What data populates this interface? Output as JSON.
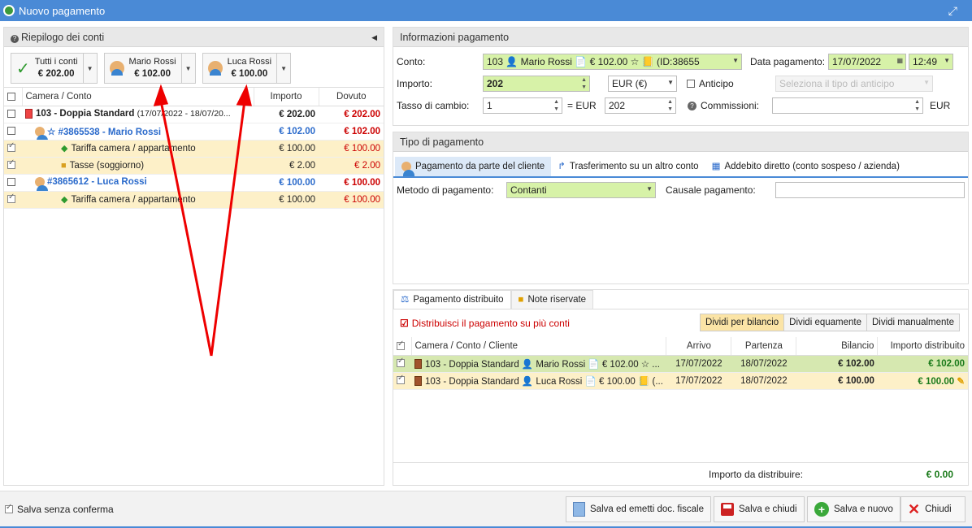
{
  "window": {
    "title": "Nuovo pagamento"
  },
  "left": {
    "title": "Riepilogo dei conti",
    "accounts": [
      {
        "name": "Tutti i conti",
        "amount": "€ 202.00"
      },
      {
        "name": "Mario Rossi",
        "amount": "€ 102.00"
      },
      {
        "name": "Luca Rossi",
        "amount": "€ 100.00"
      }
    ],
    "columns": [
      "Camera / Conto",
      "Importo",
      "Dovuto"
    ],
    "rows": [
      {
        "label": "103 - Doppia Standard",
        "sub": "(17/07/2022 - 18/07/20...",
        "importo": "€ 202.00",
        "dovuto": "€ 202.00"
      },
      {
        "label": "☆ #3865538 - Mario Rossi",
        "importo": "€ 102.00",
        "dovuto": "€ 102.00"
      },
      {
        "label": "Tariffa camera / appartamento",
        "importo": "€ 100.00",
        "dovuto": "€ 100.00"
      },
      {
        "label": "Tasse (soggiorno)",
        "importo": "€ 2.00",
        "dovuto": "€ 2.00"
      },
      {
        "label": "#3865612 - Luca Rossi",
        "importo": "€ 100.00",
        "dovuto": "€ 100.00"
      },
      {
        "label": "Tariffa camera / appartamento",
        "importo": "€ 100.00",
        "dovuto": "€ 100.00"
      }
    ]
  },
  "info": {
    "title": "Informazioni pagamento",
    "conto_label": "Conto:",
    "conto_value": "103 👤 Mario Rossi 📄 € 102.00 ☆ 📒 (ID:38655",
    "data_label": "Data pagamento:",
    "data_value": "17/07/2022",
    "time_value": "12:49",
    "importo_label": "Importo:",
    "importo_value": "202",
    "currency": "EUR (€)",
    "anticipo_label": "Anticipo",
    "anticipo_placeholder": "Seleziona il tipo di anticipo",
    "tasso_label": "Tasso di cambio:",
    "tasso_value": "1",
    "eq_eur": "= EUR",
    "eur_value": "202",
    "commissioni_label": "Commissioni:",
    "commissioni_unit": "EUR"
  },
  "tipo": {
    "title": "Tipo di pagamento",
    "tabs": [
      "Pagamento da parte del cliente",
      "Trasferimento su un altro conto",
      "Addebito diretto (conto sospeso / azienda)"
    ],
    "metodo_label": "Metodo di pagamento:",
    "metodo_value": "Contanti",
    "causale_label": "Causale pagamento:"
  },
  "distr": {
    "tabs": [
      "Pagamento distribuito",
      "Note riservate"
    ],
    "checkbox_label": "Distribuisci il pagamento su più conti",
    "split_options": [
      "Dividi per bilancio",
      "Dividi equamente",
      "Dividi manualmente"
    ],
    "columns": [
      "Camera / Conto / Cliente",
      "Arrivo",
      "Partenza",
      "Bilancio",
      "Importo distribuito"
    ],
    "rows": [
      {
        "label": "103 - Doppia Standard 👤 Mario Rossi 📄 € 102.00 ☆ ...",
        "arrivo": "17/07/2022",
        "partenza": "18/07/2022",
        "bilancio": "€ 102.00",
        "importo": "€ 102.00"
      },
      {
        "label": "103 - Doppia Standard 👤 Luca Rossi 📄 € 100.00 📒 (...",
        "arrivo": "17/07/2022",
        "partenza": "18/07/2022",
        "bilancio": "€ 100.00",
        "importo": "€ 100.00"
      }
    ],
    "footer_label": "Importo da distribuire:",
    "footer_value": "€ 0.00"
  },
  "bottom": {
    "salva_senza": "Salva senza conferma",
    "btn_fiscale": "Salva ed emetti doc. fiscale",
    "btn_chiudi_salva": "Salva e chiudi",
    "btn_nuovo": "Salva e nuovo",
    "btn_chiudi": "Chiudi"
  }
}
